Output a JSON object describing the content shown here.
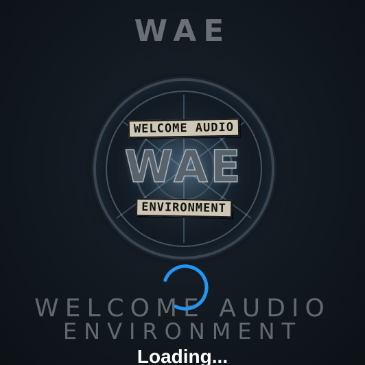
{
  "splash": {
    "app_title": "WAE",
    "logo": {
      "top_stamp": "WELCOME AUDIO",
      "wordmark": "WAE",
      "bottom_stamp": "ENVIRONMENT"
    },
    "tagline_line1": "WELCOME AUDIO",
    "tagline_line2": "ENVIRONMENT",
    "loading_text": "Loading..."
  },
  "colors": {
    "background": "#0f141a",
    "title_gray": "#6b7075",
    "spinner_accent": "#2196f3",
    "loading_text": "#ffffff"
  },
  "icons": {
    "spinner": "loading-spinner-icon"
  }
}
